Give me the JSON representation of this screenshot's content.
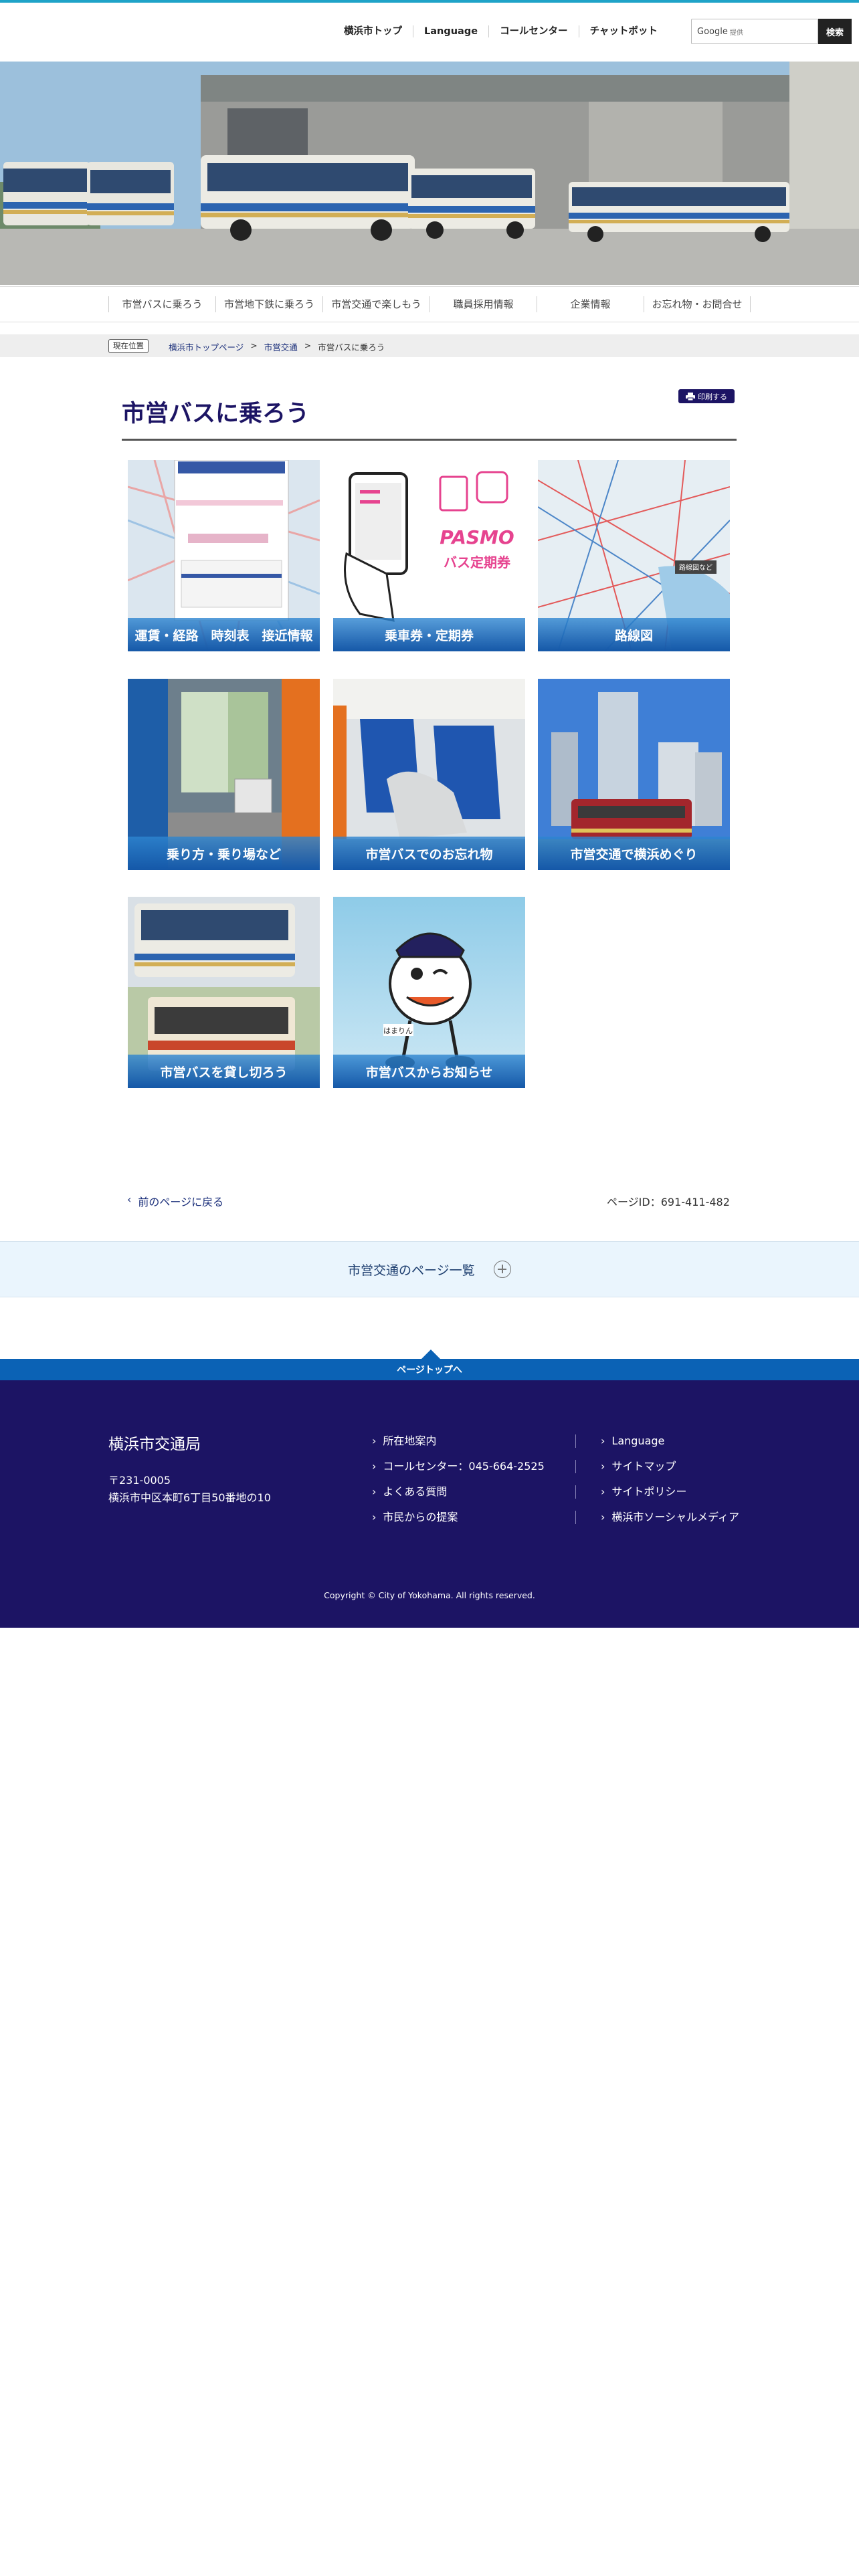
{
  "header": {
    "nav": [
      "横浜市トップ",
      "Language",
      "コールセンター",
      "チャットボット"
    ],
    "search_brand": "Google",
    "search_brand_sub": "提供",
    "search_button": "検索"
  },
  "global_nav": [
    "市営バスに乗ろう",
    "市営地下鉄に乗ろう",
    "市営交通で楽しもう",
    "職員採用情報",
    "企業情報",
    "お忘れ物・お問合せ"
  ],
  "breadcrumb": {
    "here_label": "現在位置",
    "items": [
      "横浜市トップページ",
      "市営交通",
      "市営バスに乗ろう"
    ],
    "sep": ">"
  },
  "page": {
    "title": "市営バスに乗ろう",
    "print_label": "印刷する"
  },
  "tiles": [
    {
      "label": "運賃・経路　時刻表　接近情報"
    },
    {
      "label": "乗車券・定期券",
      "art_text_1": "PASMO",
      "art_text_2": "バス定期券"
    },
    {
      "label": "路線図",
      "art_text_1": "路線図など"
    },
    {
      "label": "乗り方・乗り場など"
    },
    {
      "label": "市営バスでのお忘れ物"
    },
    {
      "label": "市営交通で横浜めぐり"
    },
    {
      "label": "市営バスを貸し切ろう"
    },
    {
      "label": "市営バスからお知らせ",
      "art_text_1": "はまりん"
    }
  ],
  "bottom": {
    "back_label": "前のページに戻る",
    "back_icon": "chevron-left-icon",
    "page_id": "ページID：691-411-482"
  },
  "list_section": {
    "label": "市営交通のページ一覧",
    "icon": "plus-circle-icon"
  },
  "totop": {
    "label": "ページトップへ"
  },
  "footer": {
    "org": "横浜市交通局",
    "zip": "〒231-0005",
    "address": "横浜市中区本町6丁目50番地の10",
    "links_left": [
      "所在地案内",
      "コールセンター：045-664-2525",
      "よくある質問",
      "市民からの提案"
    ],
    "links_right": [
      "Language",
      "サイトマップ",
      "サイトポリシー",
      "横浜市ソーシャルメディア"
    ],
    "copyright": "Copyright © City of Yokohama. All rights reserved."
  },
  "colors": {
    "brand_navy": "#1c1464",
    "accent_blue": "#0b62b5",
    "top_line": "#1fa3c8"
  }
}
